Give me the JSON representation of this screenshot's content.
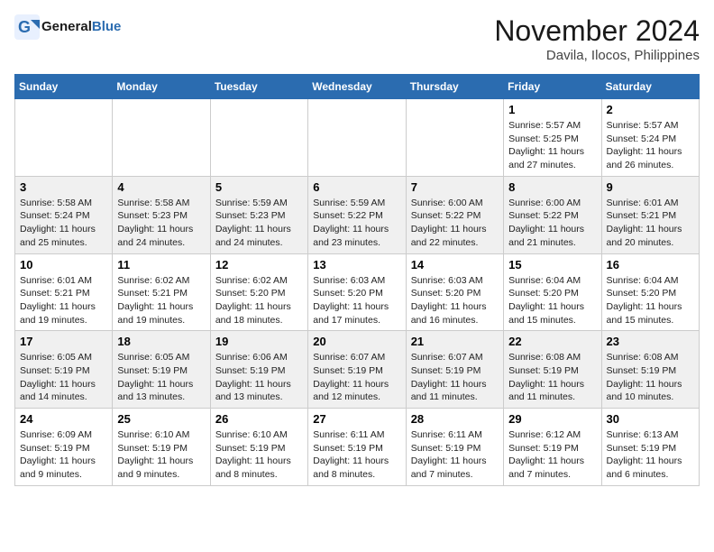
{
  "header": {
    "logo_text_general": "General",
    "logo_text_blue": "Blue",
    "month_title": "November 2024",
    "location": "Davila, Ilocos, Philippines"
  },
  "days_of_week": [
    "Sunday",
    "Monday",
    "Tuesday",
    "Wednesday",
    "Thursday",
    "Friday",
    "Saturday"
  ],
  "weeks": [
    {
      "days": [
        {
          "num": "",
          "info": ""
        },
        {
          "num": "",
          "info": ""
        },
        {
          "num": "",
          "info": ""
        },
        {
          "num": "",
          "info": ""
        },
        {
          "num": "",
          "info": ""
        },
        {
          "num": "1",
          "info": "Sunrise: 5:57 AM\nSunset: 5:25 PM\nDaylight: 11 hours and 27 minutes."
        },
        {
          "num": "2",
          "info": "Sunrise: 5:57 AM\nSunset: 5:24 PM\nDaylight: 11 hours and 26 minutes."
        }
      ]
    },
    {
      "days": [
        {
          "num": "3",
          "info": "Sunrise: 5:58 AM\nSunset: 5:24 PM\nDaylight: 11 hours and 25 minutes."
        },
        {
          "num": "4",
          "info": "Sunrise: 5:58 AM\nSunset: 5:23 PM\nDaylight: 11 hours and 24 minutes."
        },
        {
          "num": "5",
          "info": "Sunrise: 5:59 AM\nSunset: 5:23 PM\nDaylight: 11 hours and 24 minutes."
        },
        {
          "num": "6",
          "info": "Sunrise: 5:59 AM\nSunset: 5:22 PM\nDaylight: 11 hours and 23 minutes."
        },
        {
          "num": "7",
          "info": "Sunrise: 6:00 AM\nSunset: 5:22 PM\nDaylight: 11 hours and 22 minutes."
        },
        {
          "num": "8",
          "info": "Sunrise: 6:00 AM\nSunset: 5:22 PM\nDaylight: 11 hours and 21 minutes."
        },
        {
          "num": "9",
          "info": "Sunrise: 6:01 AM\nSunset: 5:21 PM\nDaylight: 11 hours and 20 minutes."
        }
      ]
    },
    {
      "days": [
        {
          "num": "10",
          "info": "Sunrise: 6:01 AM\nSunset: 5:21 PM\nDaylight: 11 hours and 19 minutes."
        },
        {
          "num": "11",
          "info": "Sunrise: 6:02 AM\nSunset: 5:21 PM\nDaylight: 11 hours and 19 minutes."
        },
        {
          "num": "12",
          "info": "Sunrise: 6:02 AM\nSunset: 5:20 PM\nDaylight: 11 hours and 18 minutes."
        },
        {
          "num": "13",
          "info": "Sunrise: 6:03 AM\nSunset: 5:20 PM\nDaylight: 11 hours and 17 minutes."
        },
        {
          "num": "14",
          "info": "Sunrise: 6:03 AM\nSunset: 5:20 PM\nDaylight: 11 hours and 16 minutes."
        },
        {
          "num": "15",
          "info": "Sunrise: 6:04 AM\nSunset: 5:20 PM\nDaylight: 11 hours and 15 minutes."
        },
        {
          "num": "16",
          "info": "Sunrise: 6:04 AM\nSunset: 5:20 PM\nDaylight: 11 hours and 15 minutes."
        }
      ]
    },
    {
      "days": [
        {
          "num": "17",
          "info": "Sunrise: 6:05 AM\nSunset: 5:19 PM\nDaylight: 11 hours and 14 minutes."
        },
        {
          "num": "18",
          "info": "Sunrise: 6:05 AM\nSunset: 5:19 PM\nDaylight: 11 hours and 13 minutes."
        },
        {
          "num": "19",
          "info": "Sunrise: 6:06 AM\nSunset: 5:19 PM\nDaylight: 11 hours and 13 minutes."
        },
        {
          "num": "20",
          "info": "Sunrise: 6:07 AM\nSunset: 5:19 PM\nDaylight: 11 hours and 12 minutes."
        },
        {
          "num": "21",
          "info": "Sunrise: 6:07 AM\nSunset: 5:19 PM\nDaylight: 11 hours and 11 minutes."
        },
        {
          "num": "22",
          "info": "Sunrise: 6:08 AM\nSunset: 5:19 PM\nDaylight: 11 hours and 11 minutes."
        },
        {
          "num": "23",
          "info": "Sunrise: 6:08 AM\nSunset: 5:19 PM\nDaylight: 11 hours and 10 minutes."
        }
      ]
    },
    {
      "days": [
        {
          "num": "24",
          "info": "Sunrise: 6:09 AM\nSunset: 5:19 PM\nDaylight: 11 hours and 9 minutes."
        },
        {
          "num": "25",
          "info": "Sunrise: 6:10 AM\nSunset: 5:19 PM\nDaylight: 11 hours and 9 minutes."
        },
        {
          "num": "26",
          "info": "Sunrise: 6:10 AM\nSunset: 5:19 PM\nDaylight: 11 hours and 8 minutes."
        },
        {
          "num": "27",
          "info": "Sunrise: 6:11 AM\nSunset: 5:19 PM\nDaylight: 11 hours and 8 minutes."
        },
        {
          "num": "28",
          "info": "Sunrise: 6:11 AM\nSunset: 5:19 PM\nDaylight: 11 hours and 7 minutes."
        },
        {
          "num": "29",
          "info": "Sunrise: 6:12 AM\nSunset: 5:19 PM\nDaylight: 11 hours and 7 minutes."
        },
        {
          "num": "30",
          "info": "Sunrise: 6:13 AM\nSunset: 5:19 PM\nDaylight: 11 hours and 6 minutes."
        }
      ]
    }
  ]
}
